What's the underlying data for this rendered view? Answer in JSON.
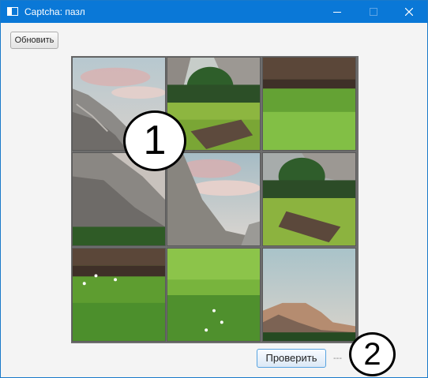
{
  "window": {
    "title": "Captcha: пазл",
    "icon": "app-window-icon",
    "controls": [
      "minimize-icon",
      "maximize-icon",
      "close-icon"
    ]
  },
  "toolbar": {
    "refresh_label": "Обновить"
  },
  "footer": {
    "check_label": "Проверить",
    "status_text": "---"
  },
  "annotations": {
    "marker_1": "1",
    "marker_2": "2"
  },
  "colors": {
    "titlebar": "#0a78d7",
    "sky": "#b9c7cf",
    "cloud_pink": "#d9b3b3",
    "rock": "#8f8c88",
    "grass": "#6ea83a",
    "forest": "#2f5b2a",
    "log": "#5a463a"
  },
  "puzzle": {
    "grid": "3x3",
    "tiles": [
      {
        "content": "sky-and-cliff"
      },
      {
        "content": "forest-and-meadow"
      },
      {
        "content": "log-and-grass"
      },
      {
        "content": "cliff-face"
      },
      {
        "content": "valley-sky-mountain"
      },
      {
        "content": "forest-meadow-log"
      },
      {
        "content": "log-flowers-grass"
      },
      {
        "content": "tall-grass-flowers"
      },
      {
        "content": "half-dome-sky"
      }
    ]
  }
}
